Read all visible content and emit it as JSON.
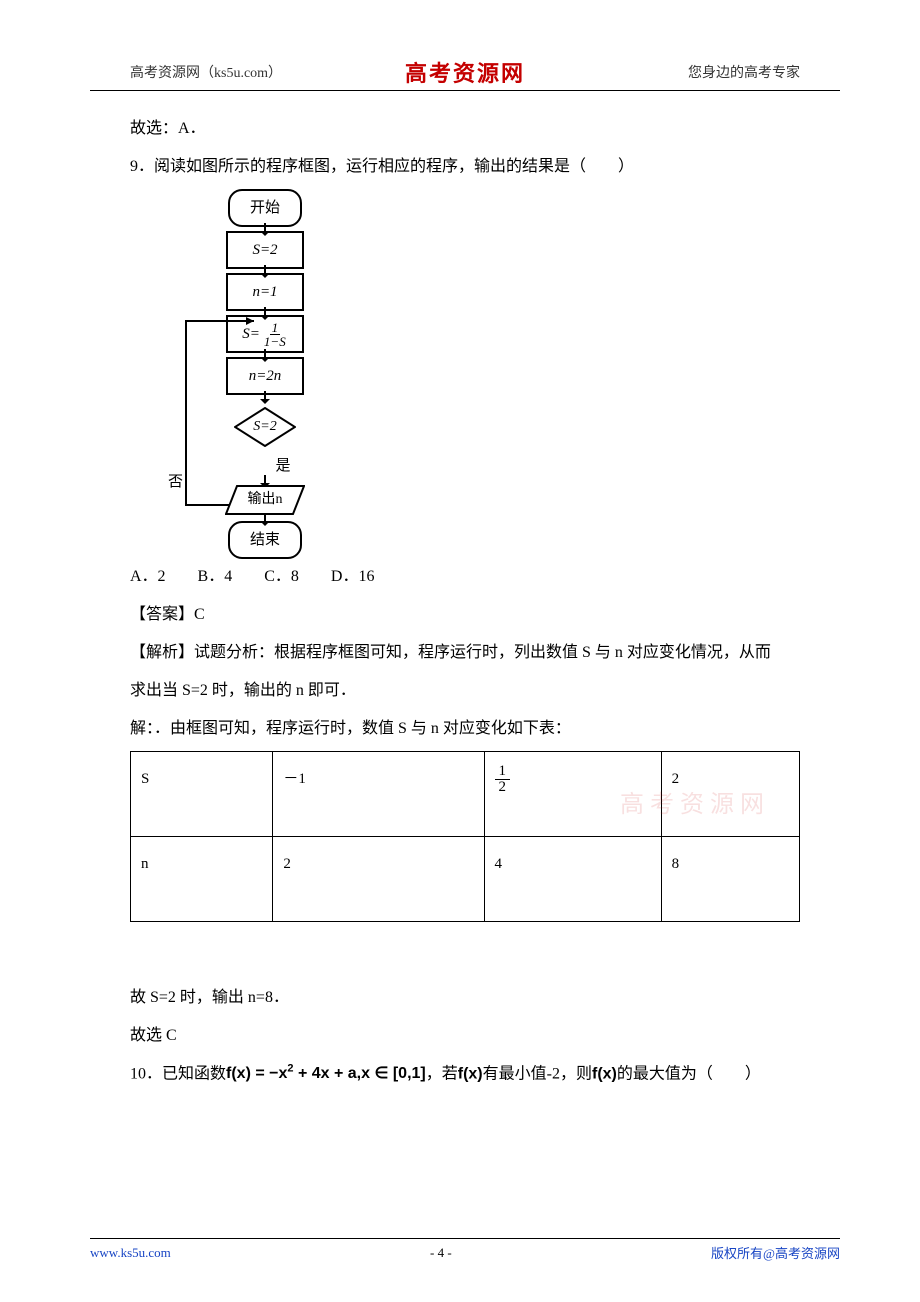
{
  "header": {
    "left": "高考资源网（ks5u.com）",
    "center": "高考资源网",
    "right": "您身边的高考专家"
  },
  "content": {
    "prev_conclusion": "故选：A．",
    "q9": {
      "stem": "9．阅读如图所示的程序框图，运行相应的程序，输出的结果是（　　）",
      "flow": {
        "start": "开始",
        "s_init": "S=2",
        "n_init": "n=1",
        "update_s_lhs": "S=",
        "update_s_num": "1",
        "update_s_den": "1−S",
        "update_n": "n=2n",
        "decision": "S=2",
        "no": "否",
        "yes": "是",
        "output_label": "输出n",
        "end": "结束"
      },
      "options": "A．2　　B．4　　C．8　　D．16",
      "answer_label": "【答案】C",
      "analysis_line1": "【解析】试题分析：根据程序框图可知，程序运行时，列出数值 S 与 n 对应变化情况，从而",
      "analysis_line2": "求出当 S=2 时，输出的 n 即可．",
      "solution_lead": "解：．由框图可知，程序运行时，数值 S 与 n 对应变化如下表：",
      "table": {
        "r1": [
          "S",
          "－1",
          {
            "frac": [
              "1",
              "2"
            ]
          },
          "2"
        ],
        "r2": [
          "n",
          "2",
          "4",
          "8"
        ]
      },
      "post_table_line1": "故 S=2 时，输出 n=8．",
      "post_table_line2": "故选 C"
    },
    "q10": {
      "prefix": "10．已知函数",
      "func": "f(x) = −x",
      "func_tail": " + 4x + a,x ∈ [0,1]",
      "mid": "，若",
      "fx": "f(x)",
      "cond": "有最小值-2，则",
      "fx2": "f(x)",
      "tail": "的最大值为（　　）"
    }
  },
  "watermark": "高考资源网",
  "footer": {
    "left": "www.ks5u.com",
    "center": "- 4 -",
    "right": "版权所有@高考资源网"
  }
}
